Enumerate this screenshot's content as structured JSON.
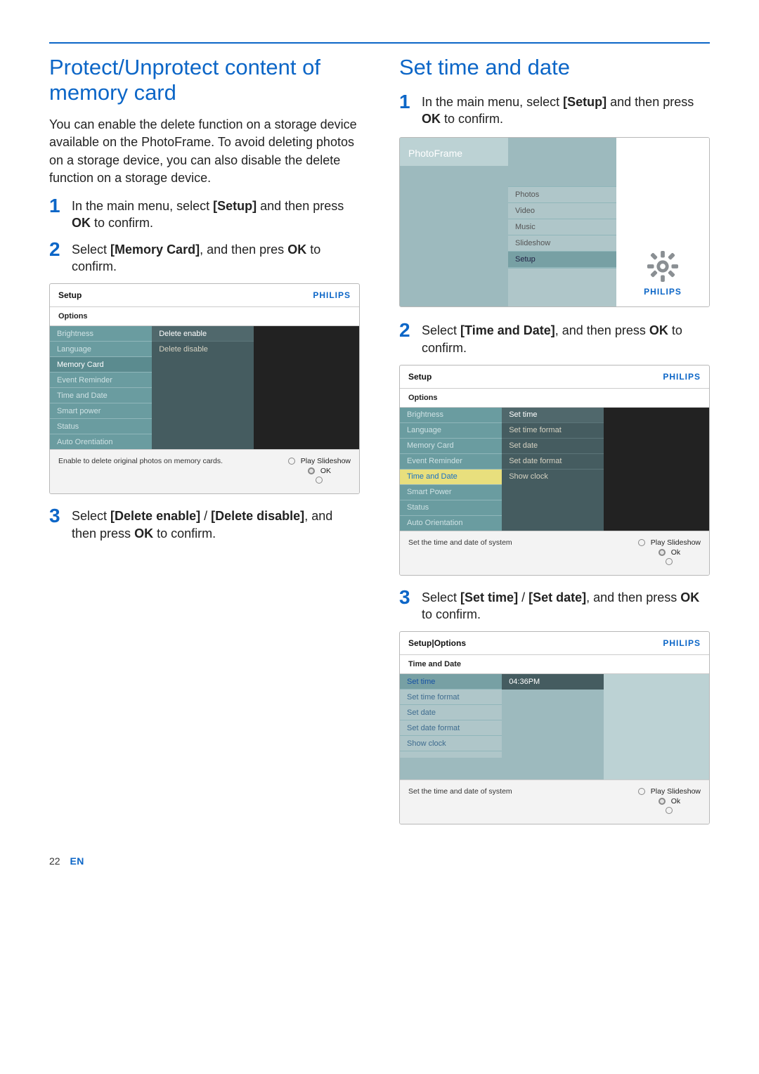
{
  "brand": "PHILIPS",
  "nav": {
    "play": "Play Slideshow",
    "ok": "OK",
    "ok2": "Ok"
  },
  "page": {
    "number": "22",
    "lang": "EN"
  },
  "left": {
    "heading": "Protect/Unprotect content of memory card",
    "intro": "You can enable the delete function on a storage device available on the PhotoFrame. To avoid deleting photos on a storage device, you can also disable the delete function on a storage device.",
    "steps": [
      {
        "n": "1",
        "a": "In the main menu, select",
        "bold1": "[Setup]",
        "b": "and then press",
        "bold2": "OK",
        "c": "to confirm."
      },
      {
        "n": "2",
        "a": "Select",
        "bold1": "[Memory Card]",
        "b": ", and then pres",
        "bold2": "OK",
        "c": "to confirm."
      },
      {
        "n": "3",
        "a": "Select",
        "bold1": "[Delete enable]",
        "slash": "/",
        "bold2": "[Delete disable]",
        "b": ", and then press",
        "bold3": "OK",
        "c": "to confirm."
      }
    ]
  },
  "right": {
    "heading": "Set time and date",
    "steps": [
      {
        "n": "1",
        "a": "In the main menu, select",
        "bold1": "[Setup]",
        "b": "and then press",
        "bold2": "OK",
        "c": "to confirm."
      },
      {
        "n": "2",
        "a": "Select",
        "bold1": "[Time and Date]",
        "b": ", and then press",
        "bold2": "OK",
        "c": "to confirm."
      },
      {
        "n": "3",
        "a": "Select",
        "bold1": "[Set time]",
        "slash": "/",
        "bold2": "[Set date]",
        "b": ", and then press",
        "bold3": "OK",
        "c": "to confirm."
      }
    ]
  },
  "screens": {
    "memory": {
      "title": "Setup",
      "subtitle": "Options",
      "left": [
        "Brightness",
        "Language",
        "Memory Card",
        "Event Reminder",
        "Time and Date",
        "Smart power",
        "Status",
        "Auto Orentiation"
      ],
      "mid": [
        "Delete enable",
        "Delete disable"
      ],
      "footer": "Enable to delete original photos on memory cards."
    },
    "photoframe": {
      "title": "PhotoFrame",
      "items": [
        "Photos",
        "Video",
        "Music",
        "Slideshow",
        "Setup"
      ]
    },
    "timedate": {
      "title": "Setup",
      "subtitle": "Options",
      "left": [
        "Brightness",
        "Language",
        "Memory Card",
        "Event Reminder",
        "Time and Date",
        "Smart Power",
        "Status",
        "Auto Orientation"
      ],
      "mid": [
        "Set time",
        "Set time format",
        "Set date",
        "Set date format",
        "Show clock"
      ],
      "footer": "Set the time and date of system"
    },
    "settime": {
      "title": "Setup|Options",
      "subtitle": "Time and Date",
      "left": [
        "Set time",
        "Set time format",
        "Set date",
        "Set date format",
        "Show clock"
      ],
      "value": "04:36PM",
      "footer": "Set the time and date of system"
    }
  }
}
